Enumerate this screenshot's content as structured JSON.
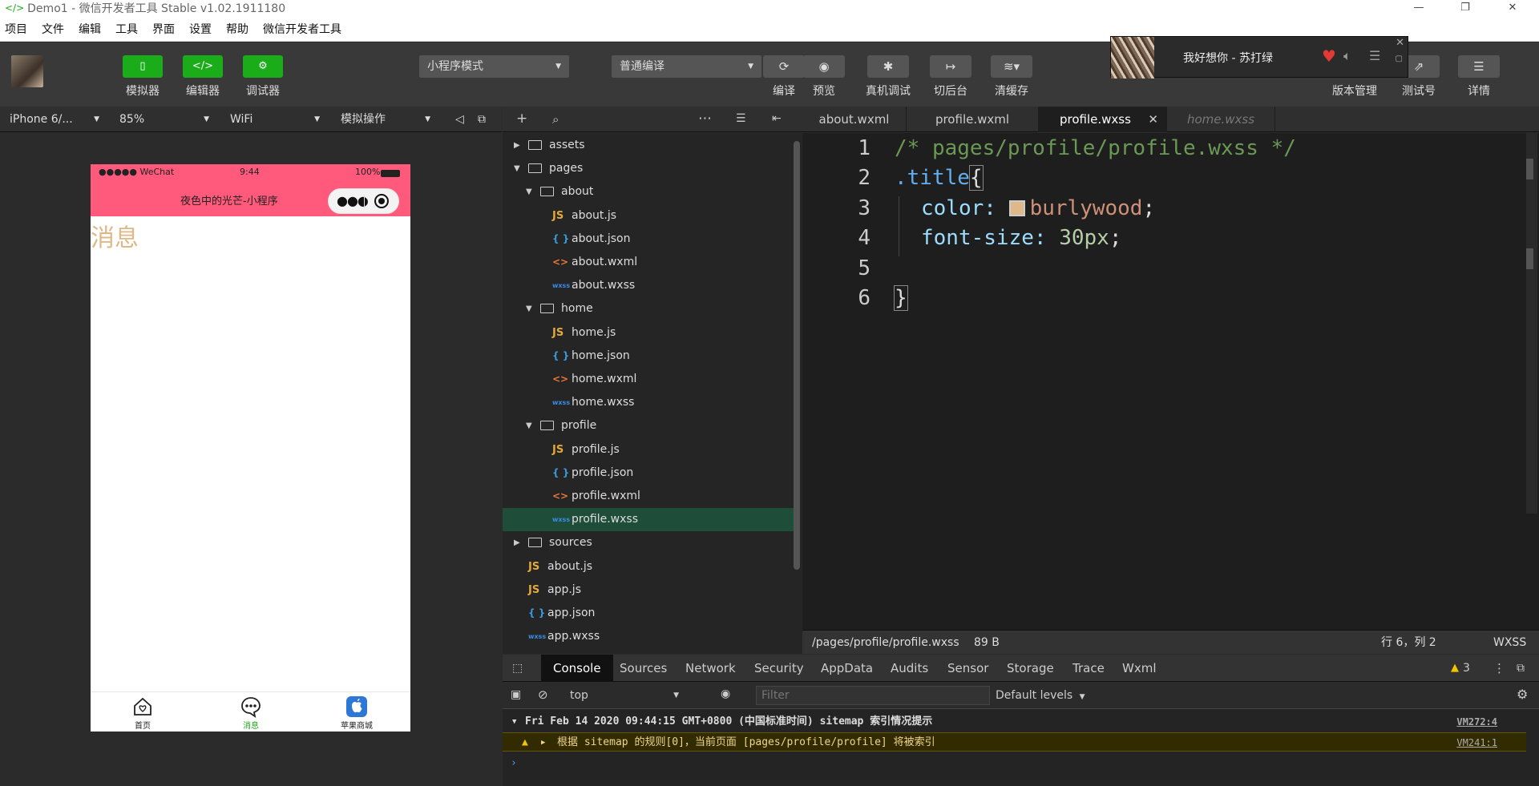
{
  "window": {
    "title": "Demo1 - 微信开发者工具 Stable v1.02.1911180",
    "controls": {
      "minimize": "—",
      "restore": "❐",
      "close": "✕"
    }
  },
  "menu": [
    "项目",
    "文件",
    "编辑",
    "工具",
    "界面",
    "设置",
    "帮助",
    "微信开发者工具"
  ],
  "toolbar": {
    "simulator": "模拟器",
    "editor": "编辑器",
    "debugger": "调试器",
    "mode_select": "小程序模式",
    "compile_select": "普通编译",
    "compile": "编译",
    "preview": "预览",
    "real_debug": "真机调试",
    "background": "切后台",
    "clear_cache": "清缓存",
    "version": "版本管理",
    "test_account": "测试号",
    "details": "详情"
  },
  "music": {
    "song": "我好想你 - 苏打绿"
  },
  "simulator": {
    "device": "iPhone 6/...",
    "zoom": "85%",
    "network": "WiFi",
    "action": "模拟操作",
    "status": {
      "carrier": "●●●●● WeChat",
      "time": "9:44",
      "battery": "100%"
    },
    "nav_title": "夜色中的光芒-小程序",
    "page_text": "消息",
    "tabs": [
      {
        "label": "首页",
        "active": false
      },
      {
        "label": "消息",
        "active": true
      },
      {
        "label": "苹果商城",
        "active": false
      }
    ]
  },
  "tree": [
    {
      "label": "assets",
      "type": "folder",
      "open": false,
      "depth": 0
    },
    {
      "label": "pages",
      "type": "folder",
      "open": true,
      "depth": 0
    },
    {
      "label": "about",
      "type": "folder",
      "open": true,
      "depth": 1
    },
    {
      "label": "about.js",
      "type": "js",
      "depth": 2
    },
    {
      "label": "about.json",
      "type": "json",
      "depth": 2
    },
    {
      "label": "about.wxml",
      "type": "wxml",
      "depth": 2
    },
    {
      "label": "about.wxss",
      "type": "wxss",
      "depth": 2
    },
    {
      "label": "home",
      "type": "folder",
      "open": true,
      "depth": 1
    },
    {
      "label": "home.js",
      "type": "js",
      "depth": 2
    },
    {
      "label": "home.json",
      "type": "json",
      "depth": 2
    },
    {
      "label": "home.wxml",
      "type": "wxml",
      "depth": 2
    },
    {
      "label": "home.wxss",
      "type": "wxss",
      "depth": 2
    },
    {
      "label": "profile",
      "type": "folder",
      "open": true,
      "depth": 1
    },
    {
      "label": "profile.js",
      "type": "js",
      "depth": 2
    },
    {
      "label": "profile.json",
      "type": "json",
      "depth": 2
    },
    {
      "label": "profile.wxml",
      "type": "wxml",
      "depth": 2
    },
    {
      "label": "profile.wxss",
      "type": "wxss",
      "depth": 2,
      "selected": true
    },
    {
      "label": "sources",
      "type": "folder",
      "open": false,
      "depth": 0
    },
    {
      "label": "about.js",
      "type": "js",
      "depth": 0
    },
    {
      "label": "app.js",
      "type": "js",
      "depth": 0
    },
    {
      "label": "app.json",
      "type": "json",
      "depth": 0
    },
    {
      "label": "app.wxss",
      "type": "wxss",
      "depth": 0
    }
  ],
  "icons": {
    "js": "JS",
    "json": "{ }",
    "wxml": "<>",
    "wxss": "wxss"
  },
  "editor": {
    "tabs": [
      "about.wxml",
      "profile.wxml",
      "profile.wxss",
      "home.wxss"
    ],
    "line_numbers": [
      "1",
      "2",
      "3",
      "4",
      "5",
      "6"
    ],
    "code": {
      "l1": "/* pages/profile/profile.wxss */",
      "l2_sel": ".title",
      "l2_brace": "{",
      "l3_prop": "color: ",
      "l3_val": "burlywood",
      "l3_end": ";",
      "l4_prop": "font-size: ",
      "l4_val": "30px",
      "l4_end": ";",
      "l6": "}"
    },
    "status": {
      "path": "/pages/profile/profile.wxss",
      "size": "89 B",
      "position": "行 6，列 2",
      "lang": "WXSS"
    }
  },
  "console": {
    "tabs": [
      "Console",
      "Sources",
      "Network",
      "Security",
      "AppData",
      "Audits",
      "Sensor",
      "Storage",
      "Trace",
      "Wxml"
    ],
    "warn_count": "3",
    "context": "top",
    "filter_placeholder": "Filter",
    "levels": "Default levels",
    "log_header": "Fri Feb 14 2020 09:44:15 GMT+0800 (中国标准时间) sitemap 索引情况提示",
    "log_header_src": "VM272:4",
    "log_warn": "根据 sitemap 的规则[0]，当前页面 [pages/profile/profile] 将被索引",
    "log_warn_src": "VM241:1"
  },
  "colors": {
    "accent": "#1aad19",
    "phone_nav": "#ff5a7b",
    "burlywood": "#deb887",
    "selected_row": "#1e4d3a"
  }
}
